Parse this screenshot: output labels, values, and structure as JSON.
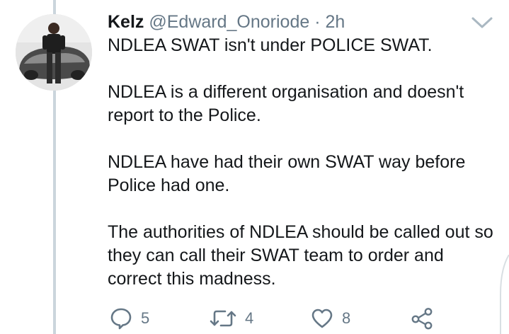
{
  "tweet": {
    "name": "Kelz",
    "handle": "@Edward_Onoriode",
    "separator": "·",
    "time": "2h",
    "paragraphs": [
      [
        "NDLEA SWAT isn't under POLICE SWAT."
      ],
      [
        "NDLEA is a different organisation and doesn't",
        "report to the Police."
      ],
      [
        "NDLEA have had their own SWAT way before",
        "Police had one."
      ],
      [
        "The authorities of NDLEA should be called out so",
        "they can call their SWAT team to order and",
        "correct this madness."
      ]
    ]
  },
  "actions": {
    "reply": {
      "icon": "reply-icon",
      "count": "5"
    },
    "retweet": {
      "icon": "retweet-icon",
      "count": "4"
    },
    "like": {
      "icon": "heart-icon",
      "count": "8"
    },
    "share": {
      "icon": "share-icon"
    }
  },
  "colors": {
    "text": "#14171a",
    "secondary": "#657786",
    "thread_line": "#cbd5dc"
  }
}
